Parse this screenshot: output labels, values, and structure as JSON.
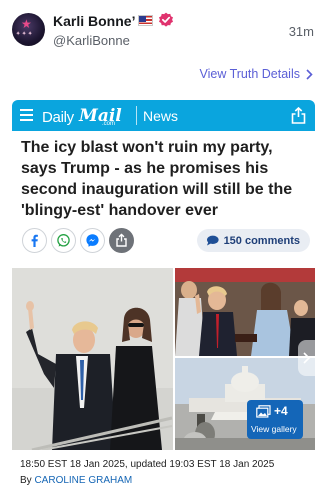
{
  "post": {
    "display_name": "Karli Bonne’",
    "handle": "@KarliBonne",
    "time_ago": "31m",
    "view_details_label": "View Truth Details",
    "icons": {
      "flag": "us-flag-icon",
      "verified": "verified-badge-icon",
      "avatar": "profile-avatar"
    },
    "colors": {
      "verified": "#e0336e",
      "link": "#5b5fd6"
    }
  },
  "card": {
    "brand_daily": "Daily",
    "brand_mail": "Mail",
    "brand_com": ".com",
    "section": "News",
    "brand_color": "#0aa5de",
    "headline": "The icy blast won't ruin my party, says Trump - as he promises his second inauguration will still be the 'blingy-est' handover ever",
    "comments_count": "150 comments",
    "gallery_count": "+4",
    "gallery_label": "View gallery",
    "timestamp": "18:50 EST 18 Jan 2025, updated 19:03 EST 18 Jan 2025",
    "byline_prefix": "By",
    "author": "CAROLINE GRAHAM",
    "share_buttons": [
      "facebook-icon",
      "whatsapp-icon",
      "messenger-icon",
      "share-icon"
    ]
  }
}
